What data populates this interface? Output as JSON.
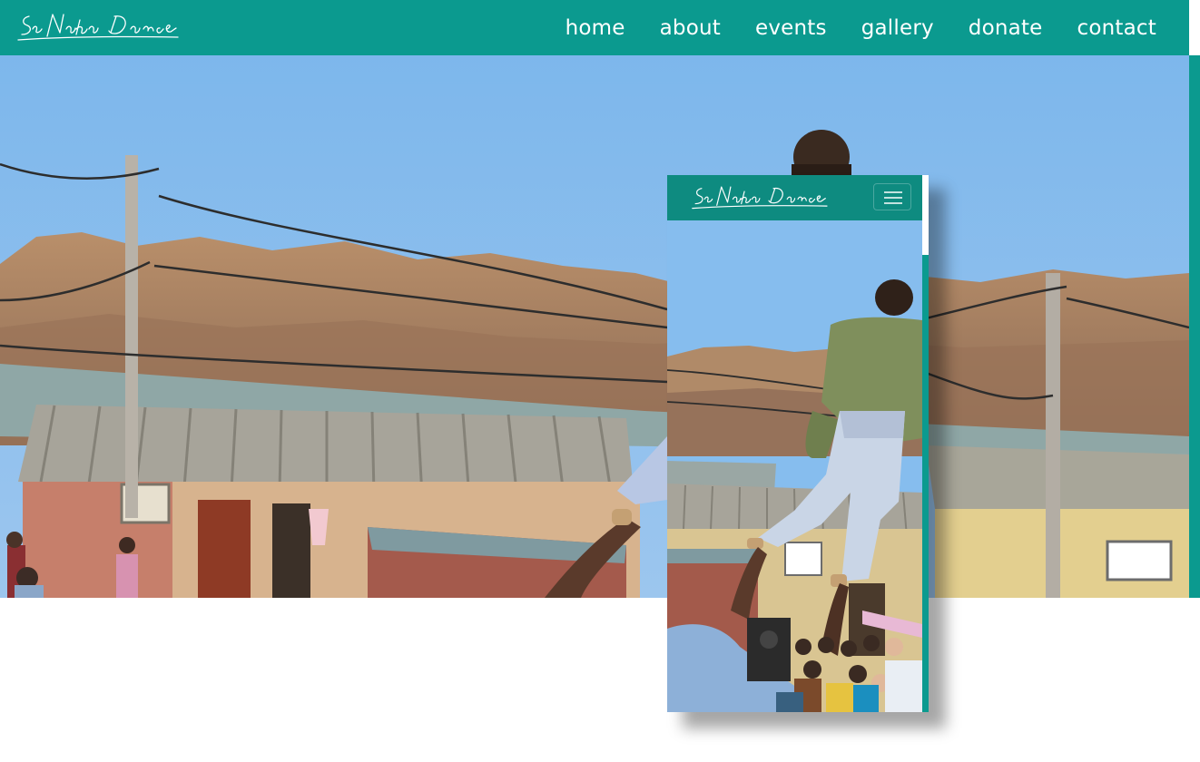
{
  "site": {
    "brand_icon": "signature-logo",
    "accent_color": "#0b9a8f"
  },
  "nav": {
    "items": [
      {
        "label": "home"
      },
      {
        "label": "about"
      },
      {
        "label": "events"
      },
      {
        "label": "gallery"
      },
      {
        "label": "donate"
      },
      {
        "label": "contact"
      }
    ]
  },
  "hero": {
    "image": "dancer-lifted-by-performer-in-township-street-with-mountains"
  },
  "mobile_preview": {
    "menu_icon": "hamburger-menu-icon"
  }
}
